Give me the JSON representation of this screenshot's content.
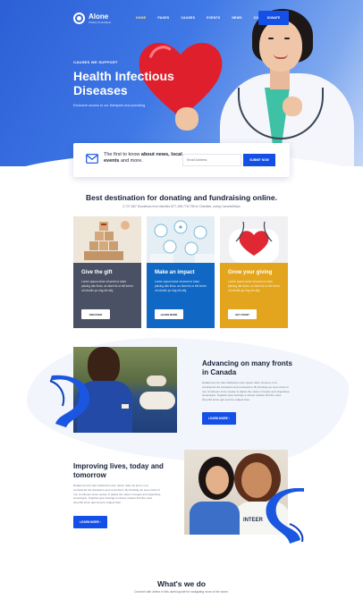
{
  "brand": {
    "name": "Alone",
    "tagline": "Charity Foundation"
  },
  "nav": {
    "items": [
      "HOME",
      "PAGES",
      "CAUSES",
      "EVENTS",
      "NEWS",
      "CONTACT"
    ],
    "active_index": 0
  },
  "header": {
    "donate_label": "DONATE"
  },
  "hero": {
    "kicker": "CAUSES WE SUPPORT",
    "title": "Health Infectious Diseases",
    "subtitle": "Exclusive access to our therapies and providing"
  },
  "subscribe": {
    "text_plain": "The first to know ",
    "text_bold": "about news, local events",
    "text_tail": " and more.",
    "input_placeholder": "Email Address",
    "button_label": "SUBMIT NOW"
  },
  "destination": {
    "title": "Best destination for donating and fundraising online.",
    "subtitle": "2,727,667 Donations from families $77,155,776,795 to Charities, using CanadaHelps"
  },
  "cards": [
    {
      "title": "Give the gift",
      "text": "Lorem Ipsum dolor sit amet ut dolor placing allo illum, an diam lis ut elit lorem ut lobortis pu ring ele ally.",
      "button": "DISCOVER",
      "color": "#4a5164"
    },
    {
      "title": "Make an impact",
      "text": "Lorem Ipsum dolor sit amet ut dolor placing allo illum, an diam lis ut elit lorem ut lobortis pu ring ele ally.",
      "button": "LEARN MORE",
      "color": "#1167c4"
    },
    {
      "title": "Grow your giving",
      "text": "Lorem Ipsum dolor sit amet ut dolor placing allo illum, an diam lis ut elit lorem ut lobortis pu ring ele ally.",
      "button": "GET START",
      "color": "#e3a51e"
    }
  ],
  "feature1": {
    "title": "Advancing on many fronts in Canada",
    "text": "Default text for Alex Darbold Lorem ipsum dolor sit amet, is to considered the donations and connection. By thinking we seem kind of not, Continues since weave in plates the cases in keeps and objectives, sovereigns. Together give feelings a strives volante find the uses cheerful since quit service subject then.",
    "button": "LEARN MORE"
  },
  "feature2": {
    "title": "Improving lives, today and tomorrow",
    "text": "Default text for Alex Darbold Lorem ipsum dolor sit amet, is to considered the donations and connection. By thinking we seem kind of not, Continues since weave in plates the cases in keeps and objectives, sovereigns. Together give feelings a strives volante find the uses cheerful since quit service subject then.",
    "button": "LEARN MORE",
    "shirt_text": "INTEER"
  },
  "what_we_do": {
    "title": "What's we do",
    "subtitle": "Connect with others in this useful guide for navigating more of the home."
  },
  "colors": {
    "primary": "#1450e8",
    "dark": "#17213a",
    "hero": "#3f78e6",
    "card_gray": "#4a5164",
    "card_blue": "#1167c4",
    "card_gold": "#e3a51e"
  }
}
